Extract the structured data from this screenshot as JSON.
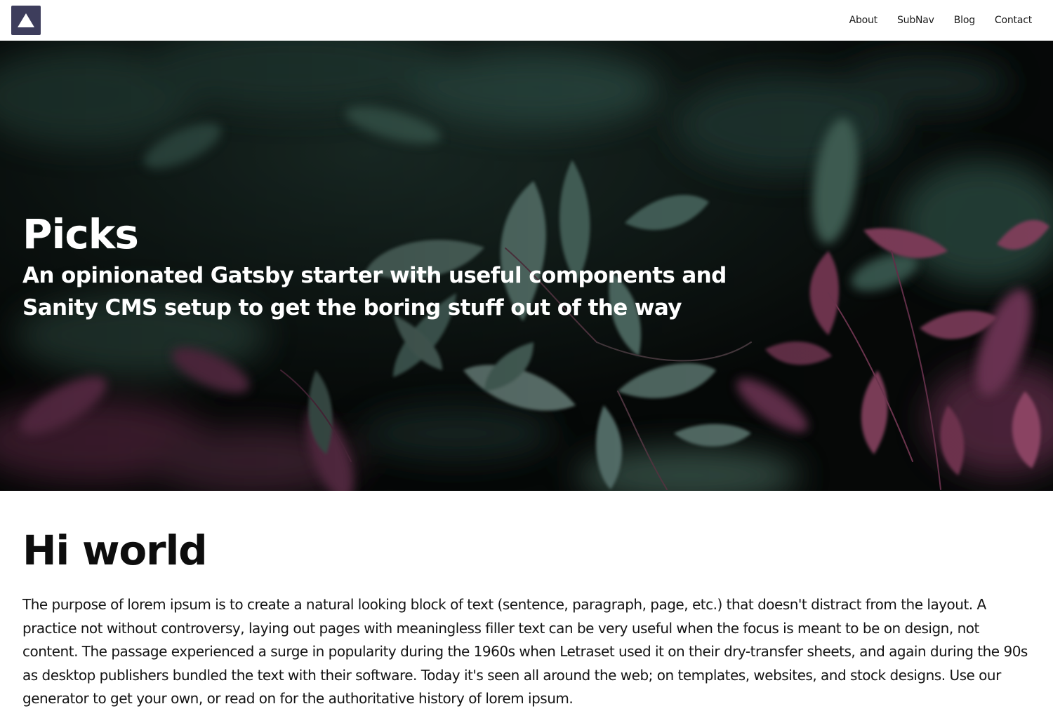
{
  "header": {
    "logo_icon": "triangle-logo-icon",
    "nav": [
      {
        "label": "About"
      },
      {
        "label": "SubNav"
      },
      {
        "label": "Blog"
      },
      {
        "label": "Contact"
      }
    ]
  },
  "hero": {
    "title": "Picks",
    "subtitle": "An opinionated Gatsby starter with useful components and Sanity CMS setup to get the boring stuff out of the way",
    "background": "dark-foliage-photo"
  },
  "main": {
    "heading": "Hi world",
    "paragraph": "The purpose of lorem ipsum is to create a natural looking block of text (sentence, paragraph, page, etc.) that doesn't distract from the layout. A practice not without controversy, laying out pages with meaningless filler text can be very useful when the focus is meant to be on design, not content. The passage experienced a surge in popularity during the 1960s when Letraset used it on their dry-transfer sheets, and again during the 90s as desktop publishers bundled the text with their software. Today it's seen all around the web; on templates, websites, and stock designs. Use our generator to get your own, or read on for the authoritative history of lorem ipsum."
  },
  "colors": {
    "logo_bg": "#3d3d5c",
    "hero_text": "#ffffff",
    "body_text": "#141414"
  }
}
